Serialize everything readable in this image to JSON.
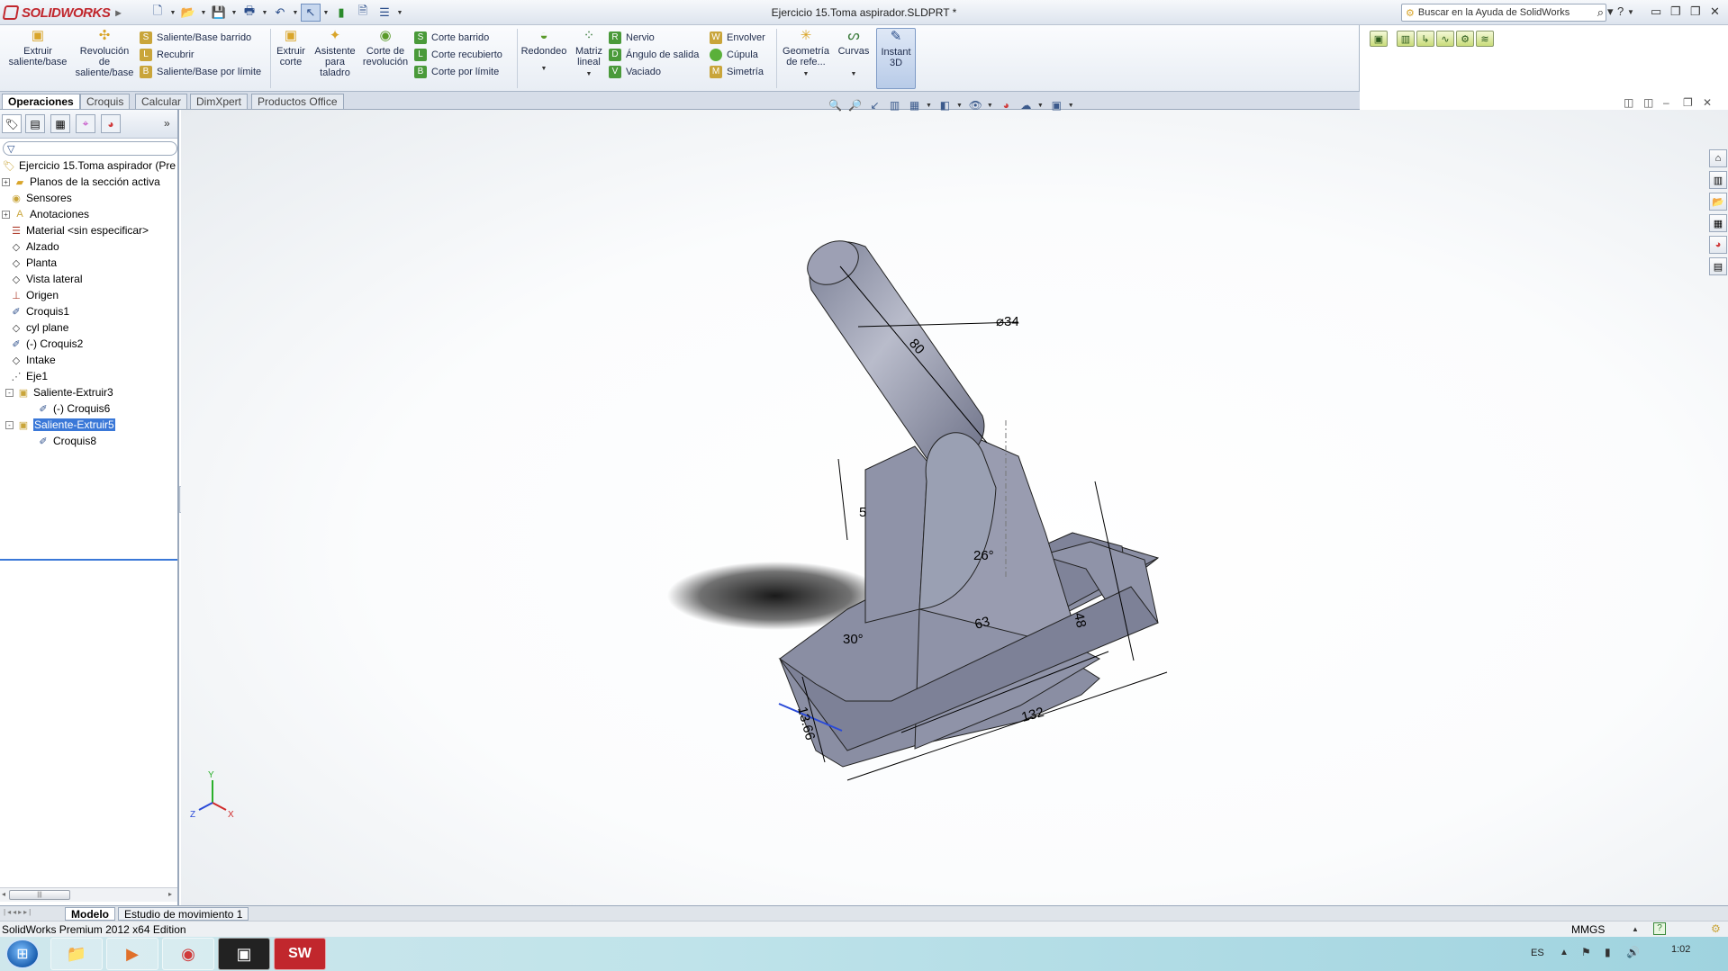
{
  "app": {
    "brand": "SOLIDWORKS",
    "document_title": "Ejercicio 15.Toma aspirador.SLDPRT *",
    "search_placeholder": "Buscar en la Ayuda de SolidWorks"
  },
  "command_manager": {
    "big_buttons": [
      {
        "label": "Extruir saliente/base",
        "icon": "extrude-boss-icon"
      },
      {
        "label": "Revolución de saliente/base",
        "icon": "revolve-boss-icon"
      },
      {
        "label": "Extruir corte",
        "icon": "extrude-cut-icon"
      },
      {
        "label": "Asistente para taladro",
        "icon": "hole-wizard-icon"
      },
      {
        "label": "Corte de revolución",
        "icon": "revolve-cut-icon"
      },
      {
        "label": "Redondeo",
        "icon": "fillet-icon"
      },
      {
        "label": "Matriz lineal",
        "icon": "linear-pattern-icon"
      },
      {
        "label": "Geometría de refe...",
        "icon": "reference-geometry-icon"
      },
      {
        "label": "Curvas",
        "icon": "curves-icon"
      },
      {
        "label": "Instant 3D",
        "icon": "instant3d-icon"
      }
    ],
    "small_col1": [
      "Saliente/Base barrido",
      "Recubrir",
      "Saliente/Base por límite"
    ],
    "small_col2": [
      "Corte barrido",
      "Corte recubierto",
      "Corte por límite"
    ],
    "small_col3": [
      "Nervio",
      "Ángulo de salida",
      "Vaciado"
    ],
    "small_col4": [
      "Envolver",
      "Cúpula",
      "Simetría"
    ]
  },
  "tabs": [
    "Operaciones",
    "Croquis",
    "Calcular",
    "DimXpert",
    "Productos Office"
  ],
  "feature_tree": {
    "root": "Ejercicio 15.Toma aspirador  (Pre",
    "items": [
      {
        "label": "Planos de la sección activa",
        "icon": "folder-icon",
        "expand": "+"
      },
      {
        "label": "Sensores",
        "icon": "sensors-icon",
        "expand": ""
      },
      {
        "label": "Anotaciones",
        "icon": "annotations-icon",
        "expand": "+"
      },
      {
        "label": "Material <sin especificar>",
        "icon": "material-icon",
        "expand": ""
      },
      {
        "label": "Alzado",
        "icon": "plane-icon",
        "expand": ""
      },
      {
        "label": "Planta",
        "icon": "plane-icon",
        "expand": ""
      },
      {
        "label": "Vista lateral",
        "icon": "plane-icon",
        "expand": ""
      },
      {
        "label": "Origen",
        "icon": "origin-icon",
        "expand": ""
      },
      {
        "label": "Croquis1",
        "icon": "sketch-icon",
        "expand": ""
      },
      {
        "label": "cyl plane",
        "icon": "plane-icon",
        "expand": ""
      },
      {
        "label": "(-) Croquis2",
        "icon": "sketch-icon",
        "expand": ""
      },
      {
        "label": "Intake",
        "icon": "plane-icon",
        "expand": ""
      },
      {
        "label": "Eje1",
        "icon": "axis-icon",
        "expand": ""
      },
      {
        "label": "Saliente-Extruir3",
        "icon": "extrude-feature-icon",
        "expand": "-"
      },
      {
        "label": "(-) Croquis6",
        "icon": "sketch-icon",
        "expand": ""
      },
      {
        "label": "Saliente-Extruir5",
        "icon": "extrude-feature-icon",
        "expand": "-"
      },
      {
        "label": "Croquis8",
        "icon": "sketch-icon",
        "expand": ""
      }
    ]
  },
  "model_dimensions": {
    "d80": "80",
    "dia34": "⌀34",
    "d5": "5",
    "angle26": "26°",
    "d63": "63",
    "d48": "48",
    "angle30": "30°",
    "d13_66": "13.66",
    "d132": "132"
  },
  "triad": {
    "x": "X",
    "y": "Y",
    "z": "Z"
  },
  "bottom_tabs": [
    "Modelo",
    "Estudio de movimiento 1"
  ],
  "status": {
    "edition": "SolidWorks Premium 2012 x64 Edition",
    "units": "MMGS"
  },
  "tray": {
    "lang": "ES",
    "time": "1:02"
  },
  "colors": {
    "selection": "#3a78d8",
    "part_face": "#8f93a8",
    "accent_red": "#c1272d"
  }
}
